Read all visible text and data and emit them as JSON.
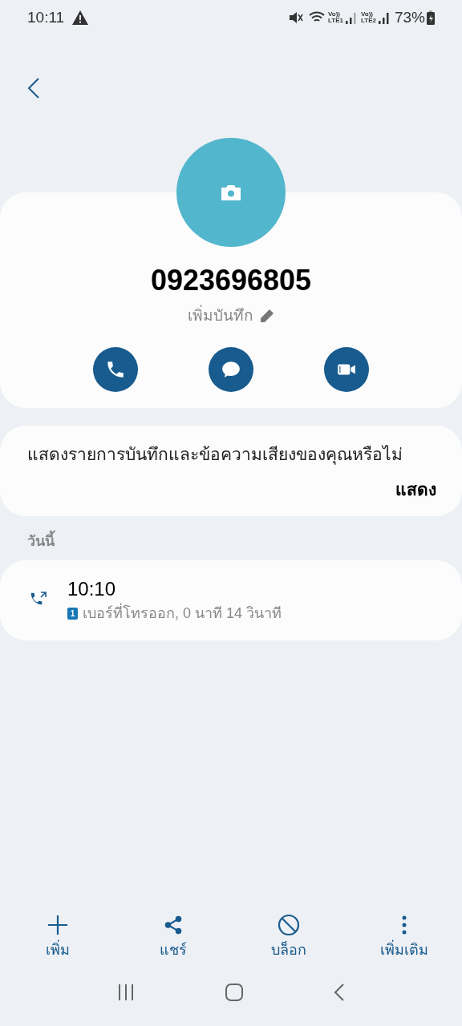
{
  "status_bar": {
    "time": "10:11",
    "volte_1": "Vo))",
    "lte_1": "LTE1",
    "volte_2": "Vo))",
    "lte_2": "LTE2",
    "battery": "73%"
  },
  "contact": {
    "number": "0923696805",
    "add_note": "เพิ่มบันทึก"
  },
  "actions": [
    {
      "kind": "call"
    },
    {
      "kind": "message"
    },
    {
      "kind": "video"
    }
  ],
  "prompt": {
    "text": "แสดงรายการบันทึกและข้อความเสียงของคุณหรือไม่",
    "button": "แสดง"
  },
  "log": {
    "section": "วันนี้",
    "entries": [
      {
        "time": "10:10",
        "sim": "1",
        "detail": "เบอร์ที่โทรออก, 0 นาที 14 วินาที"
      }
    ]
  },
  "bottom_bar": [
    {
      "kind": "add",
      "label": "เพิ่ม"
    },
    {
      "kind": "share",
      "label": "แชร์"
    },
    {
      "kind": "block",
      "label": "บล็อก"
    },
    {
      "kind": "more",
      "label": "เพิ่มเติม"
    }
  ]
}
